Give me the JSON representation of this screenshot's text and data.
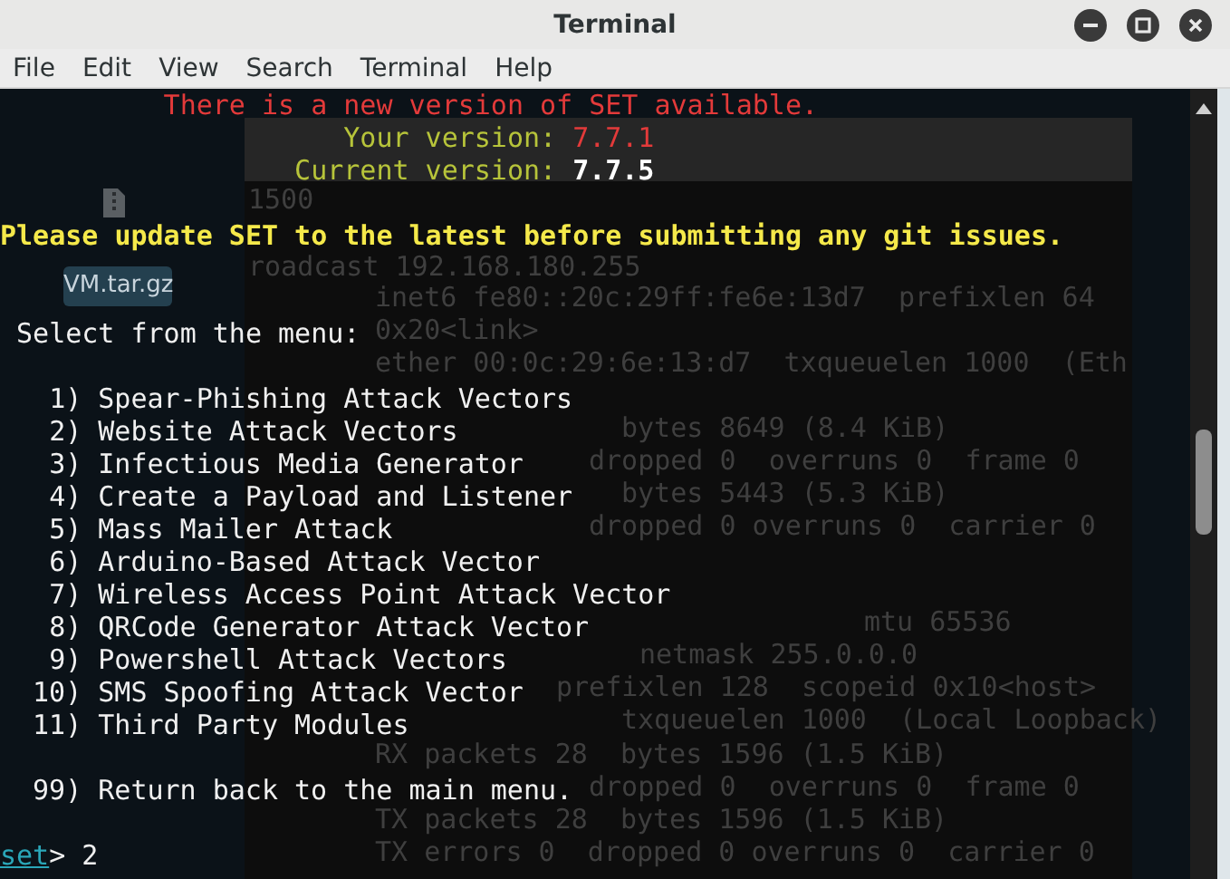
{
  "window": {
    "title": "Terminal"
  },
  "menu": [
    "File",
    "Edit",
    "View",
    "Search",
    "Terminal",
    "Help"
  ],
  "desktop": {
    "file_label": "VM.tar.gz"
  },
  "background_terminal": {
    "lines": [
      {
        "text": "1500"
      },
      {
        "text": "roadcast 192.168.180.255"
      },
      {
        "text": "inet6 fe80::20c:29ff:fe6e:13d7  prefixlen 64"
      },
      {
        "text": "0x20<link>"
      },
      {
        "text": "ether 00:0c:29:6e:13:d7  txqueuelen 1000  (Eth"
      },
      {
        "text": "bytes 8649 (8.4 KiB)"
      },
      {
        "text": "dropped 0  overruns 0  frame 0"
      },
      {
        "text": "bytes 5443 (5.3 KiB)"
      },
      {
        "text": "dropped 0 overruns 0  carrier 0"
      },
      {
        "text": "mtu 65536"
      },
      {
        "text": "netmask 255.0.0.0"
      },
      {
        "text": "prefixlen 128  scopeid 0x10<host>"
      },
      {
        "text": "txqueuelen 1000  (Local Loopback)"
      },
      {
        "text": "RX packets 28  bytes 1596 (1.5 KiB)"
      },
      {
        "text": "dropped 0  overruns 0  frame 0"
      },
      {
        "text": "TX packets 28  bytes 1596 (1.5 KiB)"
      },
      {
        "text": "TX errors 0  dropped 0 overruns 0  carrier 0"
      }
    ]
  },
  "terminal": {
    "lines": [
      {
        "kind": "warning",
        "text": "There is a new version of SET available."
      },
      {
        "kind": "version",
        "label": "Your version:",
        "value": "7.7.1",
        "current": false
      },
      {
        "kind": "version",
        "label": "Current version:",
        "value": "7.7.5",
        "current": true
      },
      {
        "kind": "blank"
      },
      {
        "kind": "update",
        "text": "Please update SET to the latest before submitting any git issues."
      },
      {
        "kind": "blank"
      },
      {
        "kind": "blank"
      },
      {
        "kind": "heading",
        "text": "Select from the menu:"
      },
      {
        "kind": "blank"
      },
      {
        "kind": "option",
        "number": "1)",
        "label": "Spear-Phishing Attack Vectors"
      },
      {
        "kind": "option",
        "number": "2)",
        "label": "Website Attack Vectors"
      },
      {
        "kind": "option",
        "number": "3)",
        "label": "Infectious Media Generator"
      },
      {
        "kind": "option",
        "number": "4)",
        "label": "Create a Payload and Listener"
      },
      {
        "kind": "option",
        "number": "5)",
        "label": "Mass Mailer Attack"
      },
      {
        "kind": "option",
        "number": "6)",
        "label": "Arduino-Based Attack Vector"
      },
      {
        "kind": "option",
        "number": "7)",
        "label": "Wireless Access Point Attack Vector"
      },
      {
        "kind": "option",
        "number": "8)",
        "label": "QRCode Generator Attack Vector"
      },
      {
        "kind": "option",
        "number": "9)",
        "label": "Powershell Attack Vectors"
      },
      {
        "kind": "option",
        "number": "10)",
        "label": "SMS Spoofing Attack Vector"
      },
      {
        "kind": "option",
        "number": "11)",
        "label": "Third Party Modules"
      },
      {
        "kind": "blank"
      },
      {
        "kind": "option",
        "number": "99)",
        "label": "Return back to the main menu."
      },
      {
        "kind": "blank"
      },
      {
        "kind": "prompt",
        "prompt": "set",
        "symbol": ">",
        "input": "2"
      }
    ]
  }
}
